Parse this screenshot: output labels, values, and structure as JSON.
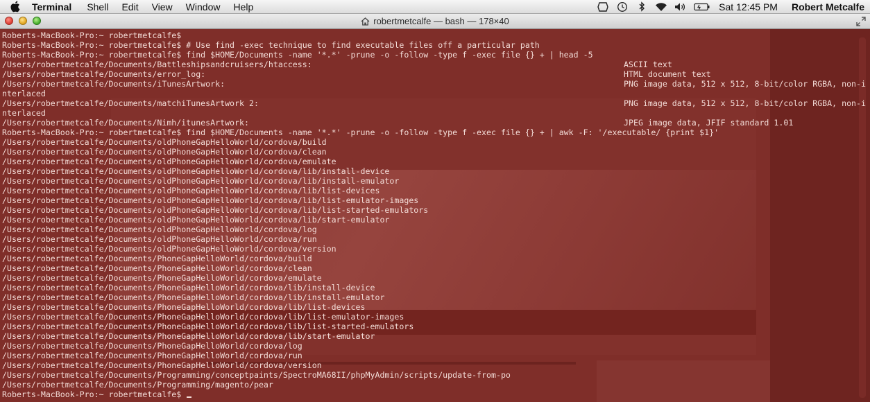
{
  "menubar": {
    "app_name": "Terminal",
    "menus": [
      "Shell",
      "Edit",
      "View",
      "Window",
      "Help"
    ],
    "clock": "Sat 12:45 PM",
    "user": "Robert Metcalfe"
  },
  "window": {
    "title": "robertmetcalfe — bash — 178×40"
  },
  "terminal": {
    "lines": [
      "Roberts-MacBook-Pro:~ robertmetcalfe$",
      "Roberts-MacBook-Pro:~ robertmetcalfe$ # Use find -exec technique to find executable files off a particular path",
      "Roberts-MacBook-Pro:~ robertmetcalfe$ find $HOME/Documents -name '*.*' -prune -o -follow -type f -exec file {} + | head -5",
      "/Users/robertmetcalfe/Documents/Battleshipsandcruisers/htaccess:",
      "/Users/robertmetcalfe/Documents/error_log:",
      "/Users/robertmetcalfe/Documents/iTunesArtwork:",
      "nterlaced",
      "/Users/robertmetcalfe/Documents/matchiTunesArtwork 2:",
      "nterlaced",
      "/Users/robertmetcalfe/Documents/Nimh/itunesArtwork:",
      "Roberts-MacBook-Pro:~ robertmetcalfe$ find $HOME/Documents -name '*.*' -prune -o -follow -type f -exec file {} + | awk -F: '/executable/ {print $1}'",
      "/Users/robertmetcalfe/Documents/oldPhoneGapHelloWorld/cordova/build",
      "/Users/robertmetcalfe/Documents/oldPhoneGapHelloWorld/cordova/clean",
      "/Users/robertmetcalfe/Documents/oldPhoneGapHelloWorld/cordova/emulate",
      "/Users/robertmetcalfe/Documents/oldPhoneGapHelloWorld/cordova/lib/install-device",
      "/Users/robertmetcalfe/Documents/oldPhoneGapHelloWorld/cordova/lib/install-emulator",
      "/Users/robertmetcalfe/Documents/oldPhoneGapHelloWorld/cordova/lib/list-devices",
      "/Users/robertmetcalfe/Documents/oldPhoneGapHelloWorld/cordova/lib/list-emulator-images",
      "/Users/robertmetcalfe/Documents/oldPhoneGapHelloWorld/cordova/lib/list-started-emulators",
      "/Users/robertmetcalfe/Documents/oldPhoneGapHelloWorld/cordova/lib/start-emulator",
      "/Users/robertmetcalfe/Documents/oldPhoneGapHelloWorld/cordova/log",
      "/Users/robertmetcalfe/Documents/oldPhoneGapHelloWorld/cordova/run",
      "/Users/robertmetcalfe/Documents/oldPhoneGapHelloWorld/cordova/version",
      "/Users/robertmetcalfe/Documents/PhoneGapHelloWorld/cordova/build",
      "/Users/robertmetcalfe/Documents/PhoneGapHelloWorld/cordova/clean",
      "/Users/robertmetcalfe/Documents/PhoneGapHelloWorld/cordova/emulate",
      "/Users/robertmetcalfe/Documents/PhoneGapHelloWorld/cordova/lib/install-device",
      "/Users/robertmetcalfe/Documents/PhoneGapHelloWorld/cordova/lib/install-emulator",
      "/Users/robertmetcalfe/Documents/PhoneGapHelloWorld/cordova/lib/list-devices",
      "/Users/robertmetcalfe/Documents/PhoneGapHelloWorld/cordova/lib/list-emulator-images",
      "/Users/robertmetcalfe/Documents/PhoneGapHelloWorld/cordova/lib/list-started-emulators",
      "/Users/robertmetcalfe/Documents/PhoneGapHelloWorld/cordova/lib/start-emulator",
      "/Users/robertmetcalfe/Documents/PhoneGapHelloWorld/cordova/log",
      "/Users/robertmetcalfe/Documents/PhoneGapHelloWorld/cordova/run",
      "/Users/robertmetcalfe/Documents/PhoneGapHelloWorld/cordova/version",
      "/Users/robertmetcalfe/Documents/Programming/conceptpaints/SpectroMA68II/phpMyAdmin/scripts/update-from-po",
      "/Users/robertmetcalfe/Documents/Programming/magento/pear",
      "Roberts-MacBook-Pro:~ robertmetcalfe$"
    ],
    "file_types": [
      {
        "line": 3,
        "text": "ASCII text"
      },
      {
        "line": 4,
        "text": "HTML document text"
      },
      {
        "line": 5,
        "text": "PNG image data, 512 x 512, 8-bit/color RGBA, non-i"
      },
      {
        "line": 7,
        "text": "PNG image data, 512 x 512, 8-bit/color RGBA, non-i"
      },
      {
        "line": 9,
        "text": "JPEG image data, JFIF standard 1.01"
      }
    ]
  },
  "colors": {
    "terminal_bg": "#7f2e29",
    "terminal_text": "#f3dcd7"
  },
  "icons": [
    "apple-logo-icon",
    "dropbox-icon",
    "time-machine-icon",
    "bluetooth-icon",
    "wifi-icon",
    "volume-icon",
    "battery-icon",
    "home-folder-icon",
    "fullscreen-icon"
  ]
}
